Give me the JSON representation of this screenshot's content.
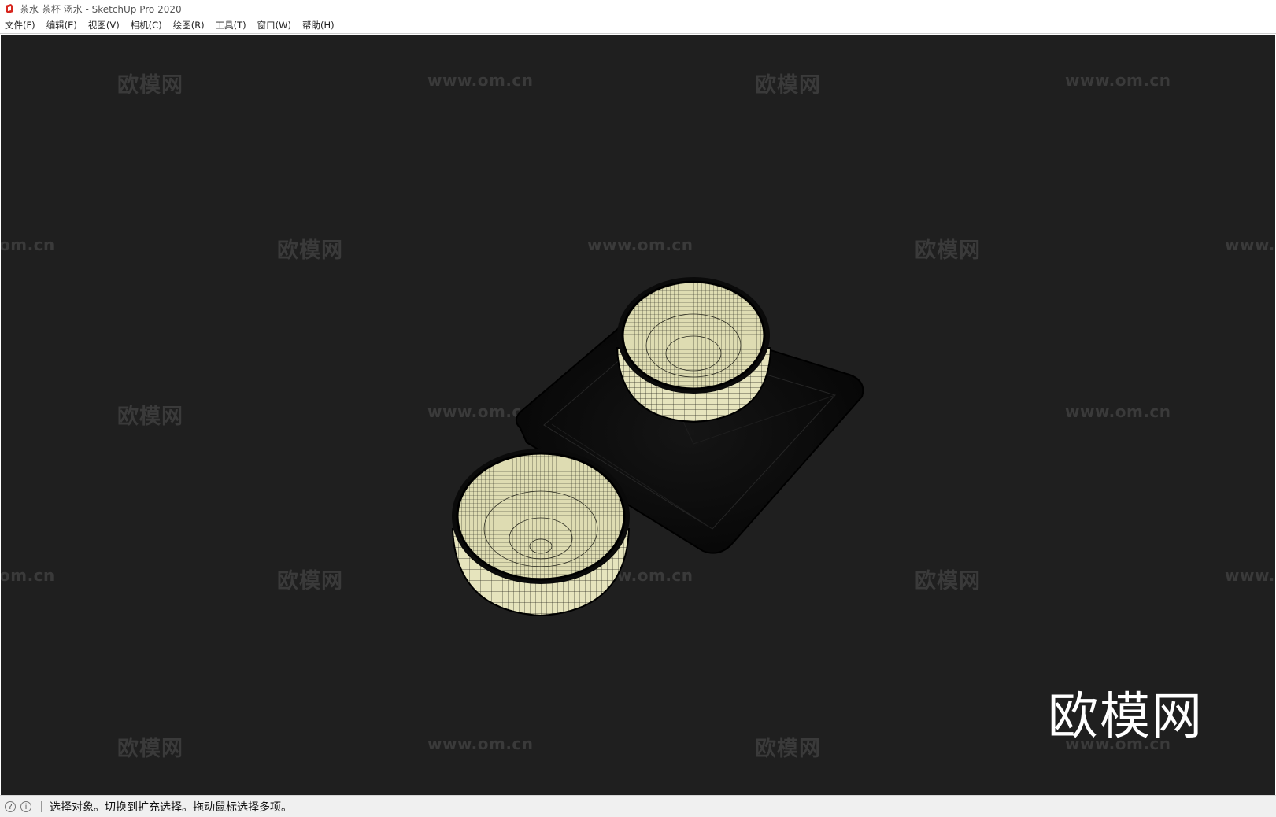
{
  "window": {
    "title": "茶水 茶杯 汤水 - SketchUp Pro 2020"
  },
  "menu": [
    "文件(F)",
    "编辑(E)",
    "视图(V)",
    "相机(C)",
    "绘图(R)",
    "工具(T)",
    "窗口(W)",
    "帮助(H)"
  ],
  "watermarks": {
    "cn": "欧模网",
    "url": "www.om.cn",
    "url_left_partial": "om.cn",
    "url_right_partial": "www."
  },
  "status": {
    "message": "选择对象。切换到扩充选择。拖动鼠标选择多项。"
  },
  "icons": {
    "app": "sketchup-logo-icon",
    "status_1": "geo-location-icon",
    "status_2": "info-icon"
  },
  "colors": {
    "viewport_bg": "#1f1f1f",
    "cup_face": "#e8e6bf",
    "tray": "#0d0d0d",
    "watermark": "#3a3a3a"
  }
}
